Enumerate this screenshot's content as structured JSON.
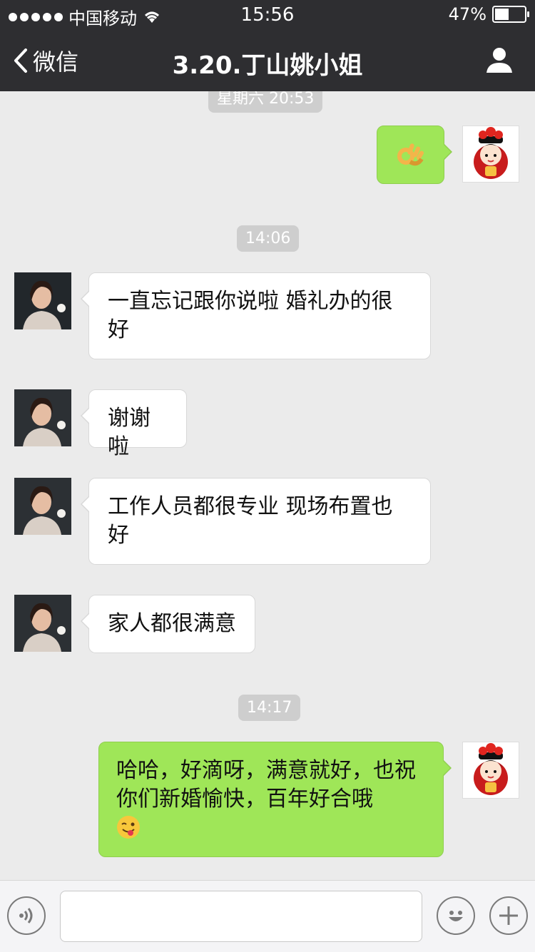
{
  "status_bar": {
    "carrier": "中国移动",
    "time": "15:56",
    "battery_percent": "47%",
    "battery_level": 0.47
  },
  "nav": {
    "back_label": "微信",
    "title": "3.20.丁山姚小姐",
    "profile_icon": "person-icon"
  },
  "messages": [
    {
      "type": "timestamp",
      "text": "星期六 20:53"
    },
    {
      "type": "sent",
      "emoji": "ok-hand-emoji"
    },
    {
      "type": "timestamp",
      "text": "14:06"
    },
    {
      "type": "received",
      "text": "一直忘记跟你说啦 婚礼办的很好"
    },
    {
      "type": "received",
      "text": "谢谢啦"
    },
    {
      "type": "received",
      "text": "工作人员都很专业 现场布置也好"
    },
    {
      "type": "received",
      "text": "家人都很满意"
    },
    {
      "type": "timestamp",
      "text": "14:17"
    },
    {
      "type": "sent",
      "text": "哈哈，好滴呀，满意就好，也祝你们新婚愉快，百年好合哦",
      "emoji": "winking-tongue-emoji"
    }
  ],
  "input_bar": {
    "voice_icon": "voice-icon",
    "emoji_icon": "smiley-icon",
    "plus_icon": "plus-icon",
    "input_value": ""
  },
  "colors": {
    "nav_bg": "#2e2e31",
    "chat_bg": "#ebebeb",
    "sent_bubble": "#9fe658",
    "received_bubble": "#ffffff"
  }
}
